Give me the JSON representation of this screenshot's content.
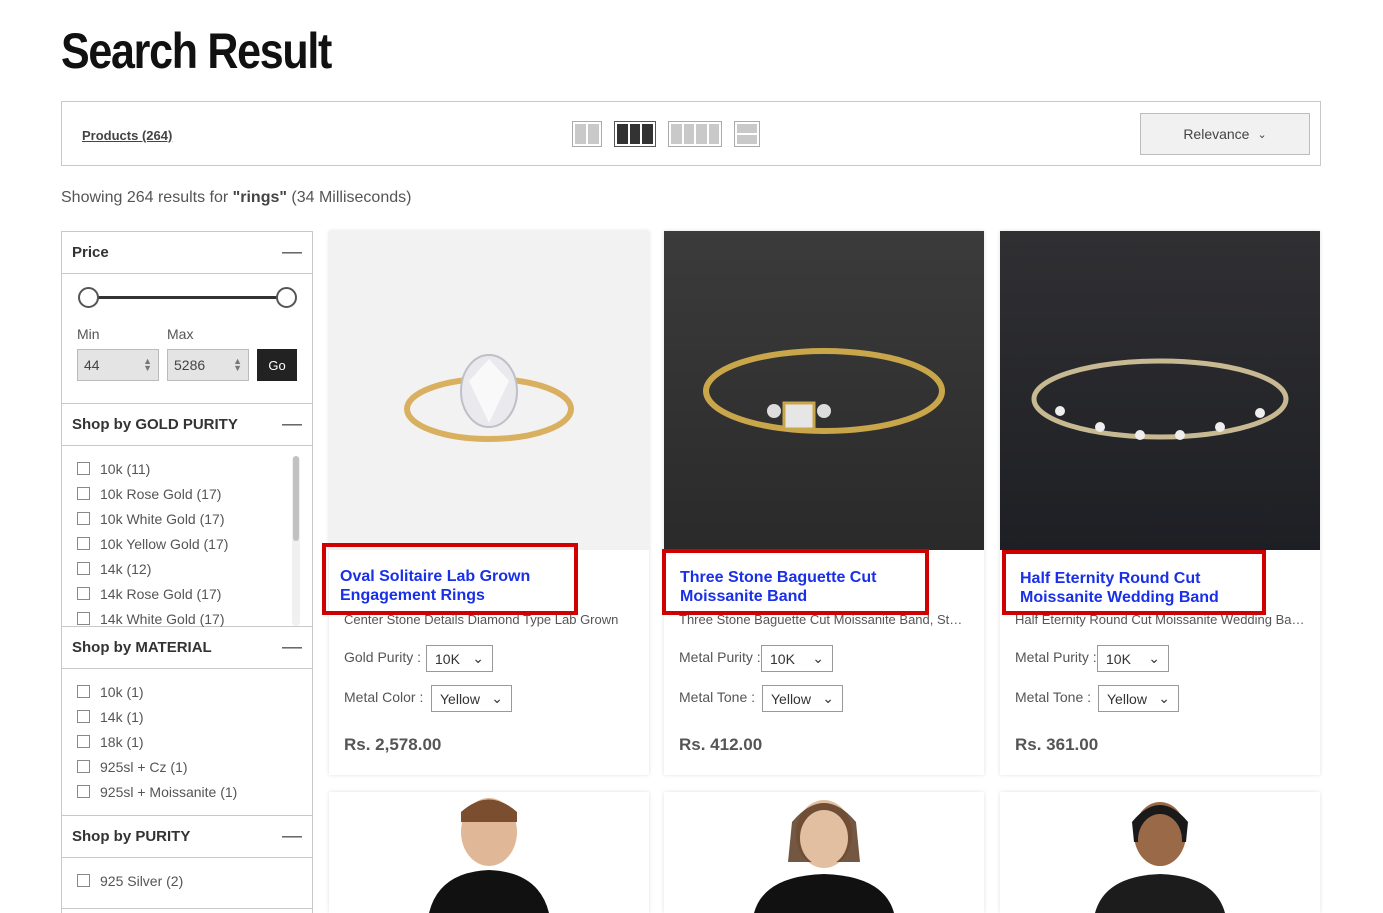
{
  "page": {
    "title": "Search Result"
  },
  "toolbar": {
    "products_label": "Products (264)",
    "sort_label": "Relevance"
  },
  "results": {
    "prefix": "Showing 264 results for ",
    "query": "\"rings\"",
    "suffix": " (34 Milliseconds)"
  },
  "filters": {
    "price": {
      "title": "Price",
      "min_label": "Min",
      "max_label": "Max",
      "min_value": "44",
      "max_value": "5286",
      "go_label": "Go"
    },
    "gold_purity": {
      "title": "Shop by GOLD PURITY",
      "items": [
        "10k (11)",
        "10k Rose Gold (17)",
        "10k White Gold (17)",
        "10k Yellow Gold (17)",
        "14k (12)",
        "14k Rose Gold (17)",
        "14k White Gold (17)"
      ]
    },
    "material": {
      "title": "Shop by MATERIAL",
      "items": [
        "10k (1)",
        "14k (1)",
        "18k (1)",
        "925sl + Cz (1)",
        "925sl + Moissanite (1)"
      ]
    },
    "purity": {
      "title": "Shop by PURITY",
      "items": [
        "925 Silver (2)"
      ]
    }
  },
  "products": [
    {
      "title_line1": "Oval Solitaire Lab Grown",
      "title_line2": "Engagement Rings",
      "desc": "Center Stone Details Diamond Type Lab Grown",
      "opt1_label": "Gold Purity :",
      "opt1_value": "10K",
      "opt2_label": "Metal Color :",
      "opt2_value": "Yellow",
      "price": "Rs. 2,578.00"
    },
    {
      "title_line1": "Three Stone Baguette Cut",
      "title_line2": "Moissanite Band",
      "desc": "Three Stone Baguette Cut Moissanite Band, Stackable",
      "opt1_label": "Metal Purity :",
      "opt1_value": "10K",
      "opt2_label": "Metal Tone :",
      "opt2_value": "Yellow",
      "price": "Rs. 412.00"
    },
    {
      "title_line1": "Half Eternity Round Cut",
      "title_line2": "Moissanite Wedding Band",
      "desc": "Half Eternity Round Cut Moissanite Wedding Band",
      "opt1_label": "Metal Purity :",
      "opt1_value": "10K",
      "opt2_label": "Metal Tone :",
      "opt2_value": "Yellow",
      "price": "Rs. 361.00"
    }
  ],
  "icons": {
    "grid2": "grid-2-icon",
    "grid3": "grid-3-icon",
    "grid4": "grid-4-icon",
    "list": "list-view-icon",
    "chevron": "chevron-down-icon",
    "collapse": "minus-icon"
  }
}
